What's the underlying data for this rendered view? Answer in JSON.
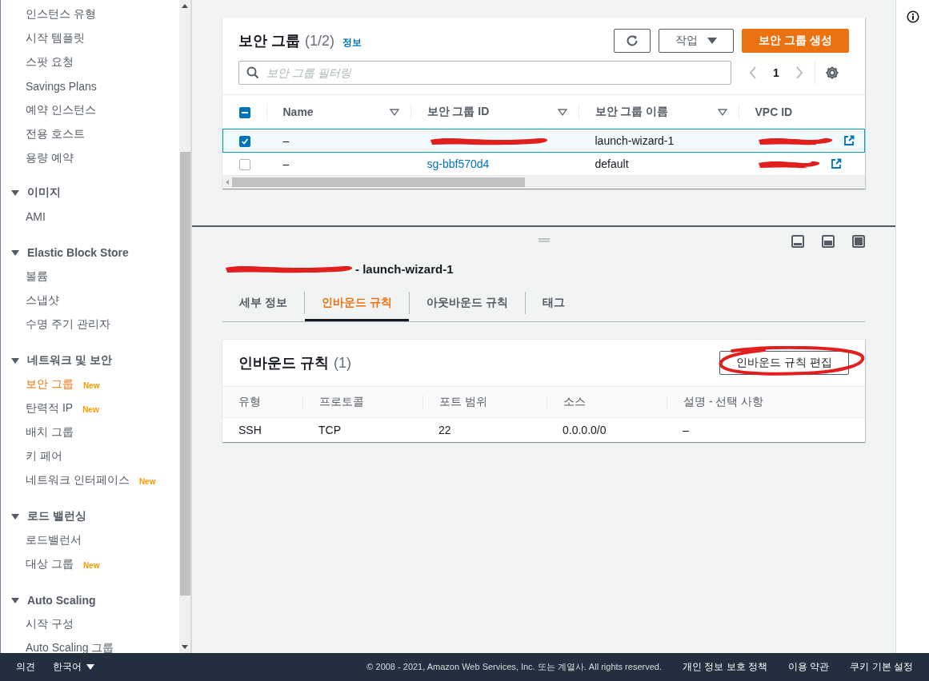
{
  "sidebar": {
    "groups": [
      {
        "items": [
          {
            "label": "인스턴스 유형",
            "selected": false
          },
          {
            "label": "시작 템플릿",
            "selected": false
          },
          {
            "label": "스팟 요청",
            "selected": false
          },
          {
            "label": "Savings Plans",
            "selected": false
          },
          {
            "label": "예약 인스턴스",
            "selected": false
          },
          {
            "label": "전용 호스트",
            "selected": false
          },
          {
            "label": "용량 예약",
            "selected": false
          }
        ]
      },
      {
        "title": "이미지",
        "expanded": true,
        "items": [
          {
            "label": "AMI",
            "selected": false
          }
        ]
      },
      {
        "title": "Elastic Block Store",
        "expanded": true,
        "items": [
          {
            "label": "볼륨",
            "selected": false
          },
          {
            "label": "스냅샷",
            "selected": false
          },
          {
            "label": "수명 주기 관리자",
            "selected": false
          }
        ]
      },
      {
        "title": "네트워크 및 보안",
        "expanded": true,
        "items": [
          {
            "label": "보안 그룹",
            "selected": true,
            "badge": "New"
          },
          {
            "label": "탄력적 IP",
            "selected": false,
            "badge": "New"
          },
          {
            "label": "배치 그룹",
            "selected": false
          },
          {
            "label": "키 페어",
            "selected": false
          },
          {
            "label": "네트워크 인터페이스",
            "selected": false,
            "badge": "New"
          }
        ]
      },
      {
        "title": "로드 밸런싱",
        "expanded": true,
        "items": [
          {
            "label": "로드밸런서",
            "selected": false
          },
          {
            "label": "대상 그룹",
            "selected": false,
            "badge": "New"
          }
        ]
      },
      {
        "title": "Auto Scaling",
        "expanded": true,
        "items": [
          {
            "label": "시작 구성",
            "selected": false
          },
          {
            "label": "Auto Scaling 그룹",
            "selected": false
          }
        ]
      }
    ]
  },
  "security_groups": {
    "title": "보안 그룹",
    "count": "(1/2)",
    "info_link": "정보",
    "actions_button": "작업",
    "create_button": "보안 그룹 생성",
    "filter": {
      "placeholder": "보안 그룹 필터링"
    },
    "page": "1",
    "select_all": {
      "indeterminate": true
    },
    "columns": [
      "Name",
      "보안 그룹 ID",
      "보안 그룹 이름",
      "VPC ID"
    ],
    "rows": [
      {
        "selected": true,
        "name": "–",
        "group_id": {
          "redacted": true
        },
        "group_name": "launch-wizard-1",
        "vpc_id": {
          "redacted": true
        }
      },
      {
        "selected": false,
        "name": "–",
        "group_id": {
          "text": "sg-bbf570d4",
          "redacted": false
        },
        "group_name": "default",
        "vpc_id": {
          "redacted": true
        }
      }
    ]
  },
  "details": {
    "title_redacted": true,
    "title": "- launch-wizard-1",
    "tabs": [
      {
        "label": "세부 정보",
        "selected": false
      },
      {
        "label": "인바운드 규칙",
        "selected": true
      },
      {
        "label": "아웃바운드 규칙",
        "selected": false
      },
      {
        "label": "태그",
        "selected": false
      }
    ],
    "rules": {
      "title": "인바운드 규칙",
      "count": "(1)",
      "edit_button": {
        "label": "인바운드 규칙 편집",
        "circled": true
      },
      "columns": [
        "유형",
        "프로토콜",
        "포트 범위",
        "소스",
        "설명 - 선택 사항"
      ],
      "rows": [
        [
          "SSH",
          "TCP",
          "22",
          "0.0.0.0/0",
          "–"
        ]
      ]
    }
  },
  "footer": {
    "feedback": "의견",
    "language": "한국어",
    "copyright": "© 2008 - 2021, Amazon Web Services, Inc. 또는 계열사. All rights reserved.",
    "links": [
      "개인 정보 보호 정책",
      "이용 약관",
      "쿠키 기본 설정"
    ]
  }
}
